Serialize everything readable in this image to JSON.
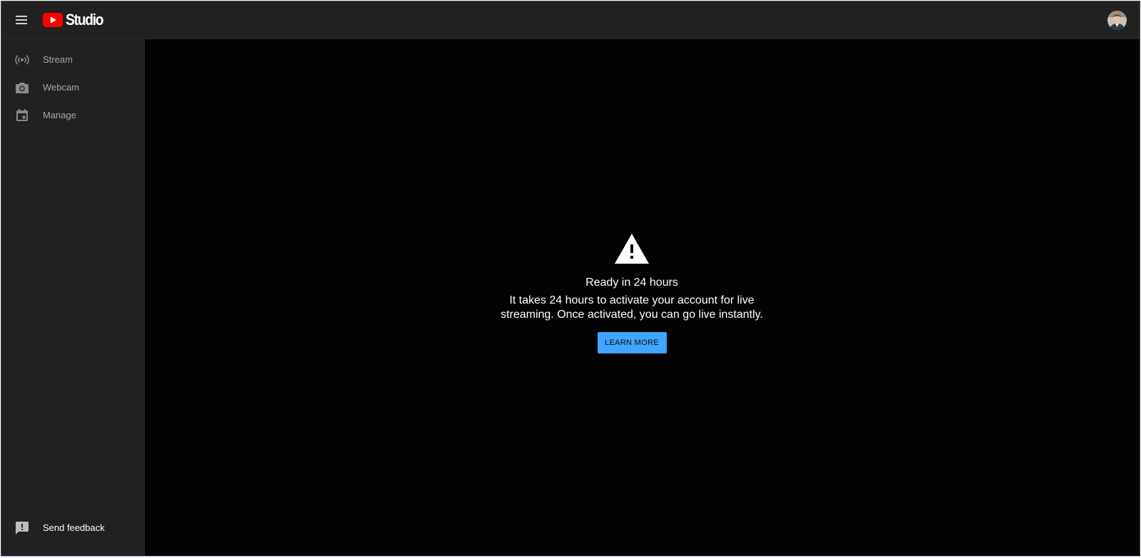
{
  "header": {
    "menu_icon": "hamburger-menu-icon",
    "logo_icon": "youtube-play-icon",
    "logo_text": "Studio",
    "brand_color": "#ff0000",
    "avatar": "account-avatar"
  },
  "sidebar": {
    "items": [
      {
        "label": "Stream",
        "icon": "broadcast-icon"
      },
      {
        "label": "Webcam",
        "icon": "camera-icon"
      },
      {
        "label": "Manage",
        "icon": "calendar-icon"
      }
    ],
    "feedback": {
      "label": "Send feedback",
      "icon": "feedback-icon"
    }
  },
  "main": {
    "notice": {
      "icon": "warning-icon",
      "title": "Ready in 24 hours",
      "body": "It takes 24 hours to activate your account for live streaming. Once activated, you can go live instantly.",
      "button_label": "LEARN MORE",
      "button_color": "#3ea6ff"
    }
  },
  "colors": {
    "header_bg": "#212121",
    "sidebar_bg": "#212121",
    "main_bg": "#030303",
    "nav_text": "#a8a8a8"
  }
}
